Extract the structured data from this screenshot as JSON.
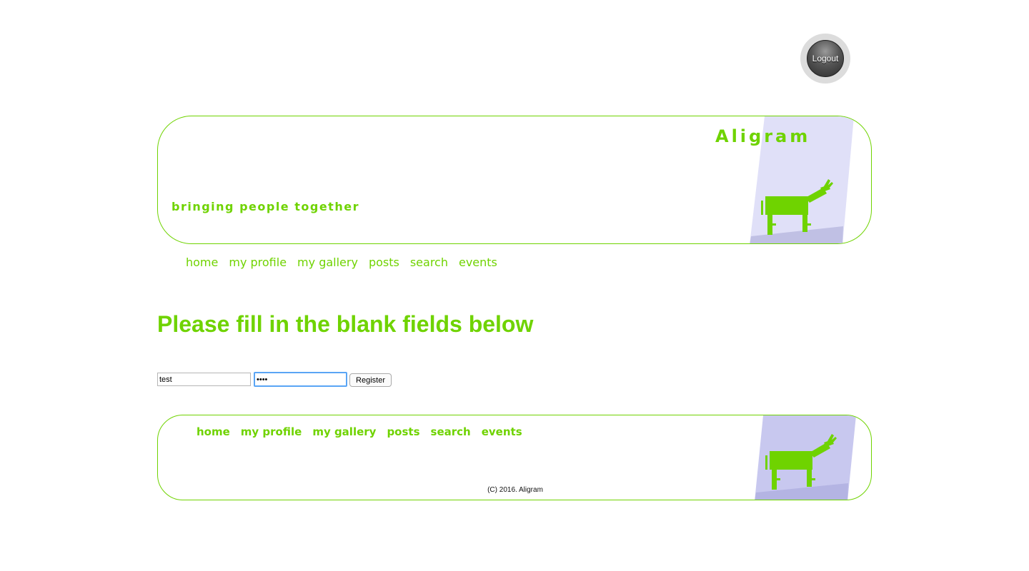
{
  "logout": {
    "label": "Logout"
  },
  "header": {
    "brand": "Aligram",
    "tagline": "bringing people together"
  },
  "nav": {
    "items": [
      "home",
      "my profile",
      "my gallery",
      "posts",
      "search",
      "events"
    ]
  },
  "main": {
    "heading": "Please fill in the blank fields below",
    "form": {
      "username_value": "test",
      "password_value": "••••",
      "register_label": "Register"
    }
  },
  "footer": {
    "nav": [
      "home",
      "my profile",
      "my gallery",
      "posts",
      "search",
      "events"
    ],
    "copyright": "(C) 2016. Aligram"
  },
  "colors": {
    "accent": "#6fd300",
    "panel_light": "#e0e0f8",
    "panel_floor": "#c0c0e4",
    "panel_footer": "#c8c8ef"
  },
  "icons": [
    "logout-button-icon",
    "donkey-mascot-icon"
  ]
}
